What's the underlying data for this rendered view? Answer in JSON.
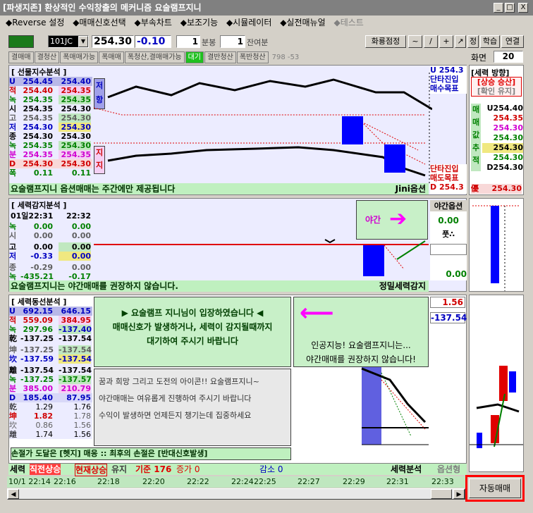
{
  "window": {
    "title": "[파생지존] 환상적인 수익창출의 메커니즘 요술램프지니",
    "min": "_",
    "max": "□",
    "close": "X"
  },
  "menu": [
    "◆Reverse 설정",
    "◆매매신호선택",
    "◆부속차트",
    "◆보조기능",
    "◆시뮬레이터",
    "◆실전매뉴얼",
    "◆테스트"
  ],
  "toolbar": {
    "code": "101JC",
    "price": "254.30",
    "change": "-0.10",
    "qty1": "1",
    "unit1": "분봉",
    "qty2": "1",
    "unit2": "잔여분",
    "right_buttons": [
      "화룡점정",
      "~",
      "/",
      "+",
      "↗",
      "정",
      "학습",
      "연결"
    ]
  },
  "modes": [
    "결매매",
    "결청산",
    "폭매매가능",
    "폭매매",
    "폭청산,결매매가능",
    "대기",
    "결반청산",
    "폭반청산"
  ],
  "mode_extra": "798 -53",
  "screen": {
    "label": "화면",
    "value": "20"
  },
  "futures": {
    "title": "[ 선물지수분석 ]",
    "rows": [
      [
        "U",
        "254.45",
        "254.40"
      ],
      [
        "적",
        "254.40",
        "254.35"
      ],
      [
        "녹",
        "254.35",
        "254.35"
      ],
      [
        "시",
        "254.35",
        "254.30"
      ],
      [
        "고",
        "254.35",
        "254.30"
      ],
      [
        "저",
        "254.30",
        "254.30"
      ],
      [
        "종",
        "254.30",
        "254.30"
      ],
      [
        "녹",
        "254.35",
        "254.30"
      ],
      [
        "분",
        "254.35",
        "254.35"
      ],
      [
        "D",
        "254.30",
        "254.30"
      ],
      [
        "폭",
        "0.11",
        "0.11"
      ]
    ],
    "side1": "저항",
    "side2": "지지",
    "note": "요술램프지니 옵션매매는 주간에만 제공됩니다",
    "brand": "Jini옵션",
    "chart_right_top": [
      "U 254.3",
      "단타진입",
      "매수목표"
    ],
    "chart_right_bot": [
      "단타진입",
      "매도목표",
      "D 254.3"
    ]
  },
  "direction": {
    "title": "[세력 방향]",
    "state": "[상승 승산]",
    "sub": "[확인 유지]",
    "vert": "매매값추적",
    "u": "U254.40",
    "vals": [
      "254.35",
      "254.30",
      "254.30",
      "254.30",
      "254.30"
    ],
    "d": "D254.30",
    "bottom_label": "優",
    "bottom_val": "254.30"
  },
  "detect": {
    "title": "[ 세력감지분석 ]",
    "time_left": "01일22:31",
    "time_right": "22:32",
    "rows": [
      [
        "녹",
        "0.00",
        "0.00"
      ],
      [
        "시",
        "0.00",
        "0.00"
      ],
      [
        "고",
        "0.00",
        "0.00"
      ],
      [
        "저",
        "-0.33",
        "0.00"
      ],
      [
        "종",
        "-0.29",
        "0.00"
      ],
      [
        "녹",
        "-435.21",
        "-0.17"
      ]
    ],
    "night": "야간",
    "night_label": "야간옵션",
    "night_val": "0.00",
    "night_sub": "풋∴",
    "night_bottom": "0.00",
    "note": "요술램프지니는 야간매매를 권장하지 않습니다.",
    "brand": "정밀세력감지"
  },
  "flow": {
    "title": "[ 세력동선분석 ]",
    "rows": [
      [
        "U",
        "692.15",
        "646.15"
      ],
      [
        "적",
        "559.09",
        "384.95"
      ],
      [
        "녹",
        "297.96",
        "-137.40"
      ],
      [
        "乾",
        "-137.25",
        "-137.54"
      ],
      [
        "坤",
        "-137.25",
        "-137.54"
      ],
      [
        "坎",
        "-137.59",
        "-137.54"
      ],
      [
        "離",
        "-137.54",
        "-137.54"
      ],
      [
        "녹",
        "-137.25",
        "-137.57"
      ],
      [
        "분",
        "385.00",
        "210.79"
      ],
      [
        "D",
        "185.40",
        "87.95"
      ],
      [
        "乾",
        "1.29",
        "1.76"
      ],
      [
        "坤",
        "1.82",
        "1.78"
      ],
      [
        "坎",
        "0.86",
        "1.56"
      ],
      [
        "離",
        "1.74",
        "1.56"
      ]
    ],
    "msg1": [
      "▶ 요술램프 지니님이 입장하였습니다 ◀",
      "매매신호가 발생하거나, 세력이 감지될때까지",
      "대기하여 주시기 바랍니다"
    ],
    "msg2": [
      "인공지능! 요술램프지니는...",
      "야간매매를 권장하지 않습니다!"
    ],
    "msg3": [
      "꿈과 희망 그리고 도전의 아이콘!! 요술램프지니~",
      "야간매매는 여유롭게 진행하여 주시기 바랍니다",
      "수익이 발생하면 언제든지 챙기는데 집중하세요"
    ],
    "val1": "1.56",
    "val2": "-137.54",
    "note": "손절가 도달은 [헷지] 매응 :: 최후의 손절은 [반대신호발생]"
  },
  "status": {
    "label": "세력",
    "s1": "직전상승",
    "s2": "현재상승",
    "s3": "유지",
    "s4": "기준 176",
    "s5": "증가 0",
    "s6": "감소 0",
    "s7": "세력분석",
    "s8": "옵션형"
  },
  "times": [
    "10/1 22:14",
    "22:16",
    "22:18",
    "22:20",
    "22:22",
    "22:24",
    "22:25",
    "22:27",
    "22:29",
    "22:31",
    "22:33"
  ],
  "auto_button": "자동매매",
  "colors": {
    "panel": "#ececff",
    "note": "#c8f0c8",
    "accent": "#ff0000",
    "bar": "#0000ff"
  }
}
